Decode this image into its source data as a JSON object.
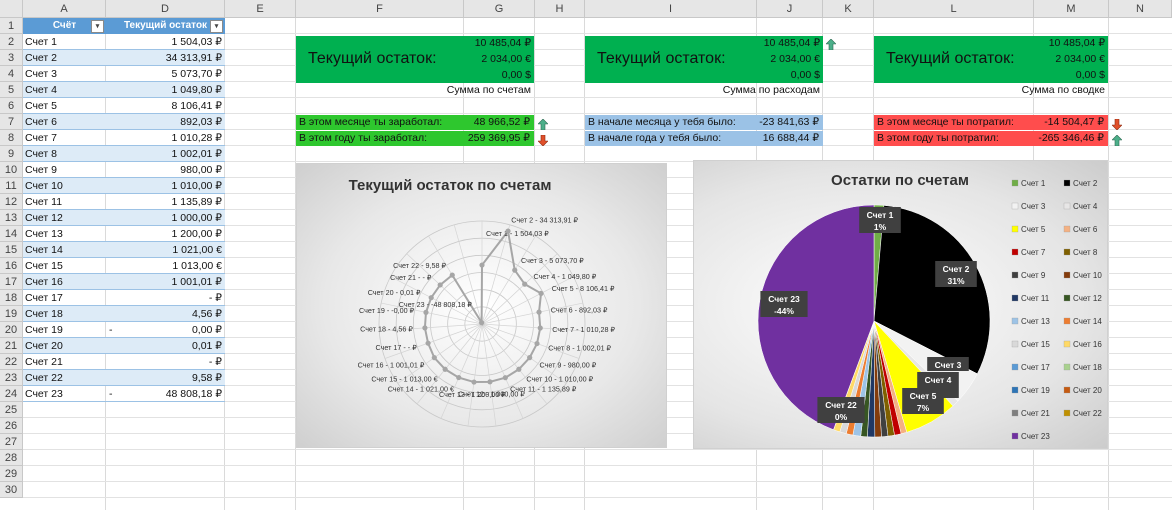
{
  "columns": [
    "A",
    "D",
    "E",
    "F",
    "G",
    "H",
    "I",
    "J",
    "K",
    "L",
    "M",
    "N"
  ],
  "rows": [
    "1",
    "2",
    "3",
    "4",
    "5",
    "6",
    "7",
    "8",
    "9",
    "10",
    "11",
    "12",
    "13",
    "14",
    "15",
    "16",
    "17",
    "18",
    "19",
    "20",
    "21",
    "22",
    "23",
    "24",
    "25",
    "26",
    "27",
    "28",
    "29",
    "30"
  ],
  "table": {
    "header_account": "Счёт",
    "header_balance": "Текущий остаток",
    "accounts": [
      {
        "name": "Счет 1",
        "minus": "",
        "value": "1 504,03 ₽"
      },
      {
        "name": "Счет 2",
        "minus": "",
        "value": "34 313,91 ₽"
      },
      {
        "name": "Счет 3",
        "minus": "",
        "value": "5 073,70 ₽"
      },
      {
        "name": "Счет 4",
        "minus": "",
        "value": "1 049,80 ₽"
      },
      {
        "name": "Счет 5",
        "minus": "",
        "value": "8 106,41 ₽"
      },
      {
        "name": "Счет 6",
        "minus": "",
        "value": "892,03 ₽"
      },
      {
        "name": "Счет 7",
        "minus": "",
        "value": "1 010,28 ₽"
      },
      {
        "name": "Счет 8",
        "minus": "",
        "value": "1 002,01 ₽"
      },
      {
        "name": "Счет 9",
        "minus": "",
        "value": "980,00 ₽"
      },
      {
        "name": "Счет 10",
        "minus": "",
        "value": "1 010,00 ₽"
      },
      {
        "name": "Счет 11",
        "minus": "",
        "value": "1 135,89 ₽"
      },
      {
        "name": "Счет 12",
        "minus": "",
        "value": "1 000,00 ₽"
      },
      {
        "name": "Счет 13",
        "minus": "",
        "value": "1 200,00 ₽"
      },
      {
        "name": "Счет 14",
        "minus": "",
        "value": "1 021,00 €"
      },
      {
        "name": "Счет 15",
        "minus": "",
        "value": "1 013,00 €"
      },
      {
        "name": "Счет 16",
        "minus": "",
        "value": "1 001,01 ₽"
      },
      {
        "name": "Счет 17",
        "minus": "",
        "value": "-     ₽"
      },
      {
        "name": "Счет 18",
        "minus": "",
        "value": "4,56 ₽"
      },
      {
        "name": "Счет 19",
        "minus": "-",
        "value": "0,00 ₽"
      },
      {
        "name": "Счет 20",
        "minus": "",
        "value": "0,01 ₽"
      },
      {
        "name": "Счет 21",
        "minus": "",
        "value": "-     ₽"
      },
      {
        "name": "Счет 22",
        "minus": "",
        "value": "9,58 ₽"
      },
      {
        "name": "Счет 23",
        "minus": "-",
        "value": "48 808,18 ₽"
      }
    ]
  },
  "panels": {
    "accounts": {
      "label": "Текущий остаток:",
      "v1": "10 485,04 ₽",
      "v2": "2 034,00 €",
      "v3": "0,00 $",
      "caption": "Сумма по счетам"
    },
    "expenses": {
      "label": "Текущий остаток:",
      "v1": "10 485,04 ₽",
      "v2": "2 034,00 €",
      "v3": "0,00 $",
      "caption": "Сумма по расходам"
    },
    "summary": {
      "label": "Текущий остаток:",
      "v1": "10 485,04 ₽",
      "v2": "2 034,00 €",
      "v3": "0,00 $",
      "caption": "Сумма по сводке"
    }
  },
  "earned": {
    "month_label": "В этом месяце ты заработал:",
    "month_value": "48 966,52 ₽",
    "year_label": "В этом году ты заработал:",
    "year_value": "259 369,95 ₽"
  },
  "start": {
    "month_label": "В начале месяца у тебя было:",
    "month_value": "-23 841,63 ₽",
    "year_label": "В начале года у тебя было:",
    "year_value": "16 688,44 ₽"
  },
  "spent": {
    "month_label": "В этом месяце ты потратил:",
    "month_value": "-14 504,47 ₽",
    "year_label": "В этом году ты потратил:",
    "year_value": "-265 346,46 ₽"
  },
  "colors": {
    "green": "#00b050",
    "green_light": "#2ec72e",
    "blue": "#9bc2e6",
    "red": "#ff4d4d",
    "header_blue": "#5b9bd5",
    "band": "#ddebf7",
    "up_arrow": "#4caf8a",
    "down_arrow": "#e0502a"
  },
  "icons": [
    "up-arrow-icon",
    "down-arrow-icon",
    "filter-dropdown-icon"
  ],
  "chart_data": [
    {
      "type": "radar",
      "title": "Текущий остаток по счетам",
      "categories": [
        "Счет 1",
        "Счет 2",
        "Счет 3",
        "Счет 4",
        "Счет 5",
        "Счет 6",
        "Счет 7",
        "Счет 8",
        "Счет 9",
        "Счет 10",
        "Счет 11",
        "Счет 12",
        "Счет 13",
        "Счет 14",
        "Счет 15",
        "Счет 16",
        "Счет 17",
        "Счет 18",
        "Счет 19",
        "Счет 20",
        "Счет 21",
        "Счет 22",
        "Счет 23"
      ],
      "values": [
        1504.03,
        34313.91,
        5073.7,
        1049.8,
        8106.41,
        892.03,
        1010.28,
        1002.01,
        980.0,
        1010.0,
        1135.89,
        1000.0,
        1200.0,
        1021.0,
        1013.0,
        1001.01,
        0,
        4.56,
        -0.0,
        0.01,
        0,
        9.58,
        -48808.18
      ],
      "data_labels": [
        "Счет 1 - 1 504,03 ₽",
        "Счет 2 - 34 313,91 ₽",
        "Счет 3 - 5 073,70 ₽",
        "Счет 4 - 1 049,80 ₽",
        "Счет 5 - 8 106,41 ₽",
        "Счет 6 - 892,03 ₽",
        "Счет 7 - 1 010,28 ₽",
        "Счет 8 - 1 002,01 ₽",
        "Счет 9 - 980,00 ₽",
        "Счет 10 - 1 010,00 ₽",
        "Счет 11 - 1 135,89 ₽",
        "Счет 12 - 1 000,00 ₽",
        "Счет 13 - 1 200,00 ₽",
        "Счет 14 - 1 021,00 €",
        "Счет 15 - 1 013,00 €",
        "Счет 16 - 1 001,01 ₽",
        "Счет 17 - - ₽",
        "Счет 18 - 4,56 ₽",
        "Счет 19 - -0,00 ₽",
        "Счет 20 - 0,01 ₽",
        "Счет 21 - - ₽",
        "Счет 22 - 9,58 ₽",
        "Счет 23 - -48 808,18 ₽"
      ]
    },
    {
      "type": "pie",
      "title": "Остатки по счетам",
      "legend_position": "right",
      "slices": [
        {
          "name": "Счет 1",
          "pct_label": "1%",
          "color": "#70ad47"
        },
        {
          "name": "Счет 2",
          "pct_label": "31%",
          "color": "#000000"
        },
        {
          "name": "Счет 3",
          "pct_label": "",
          "color": "#f2f2f2"
        },
        {
          "name": "Счет 4",
          "pct_label": "",
          "color": "#e7e6e6"
        },
        {
          "name": "Счет 5",
          "pct_label": "",
          "color": "#ffff00"
        },
        {
          "name": "Счет 6",
          "pct_label": "",
          "color": "#f4b183"
        },
        {
          "name": "Счет 7",
          "pct_label": "",
          "color": "#c00000"
        },
        {
          "name": "Счет 8",
          "pct_label": "",
          "color": "#7f6000"
        },
        {
          "name": "Счет 9",
          "pct_label": "",
          "color": "#404040"
        },
        {
          "name": "Счет 10",
          "pct_label": "",
          "color": "#843c0c"
        },
        {
          "name": "Счет 11",
          "pct_label": "",
          "color": "#203864"
        },
        {
          "name": "Счет 12",
          "pct_label": "",
          "color": "#375623"
        },
        {
          "name": "Счет 13",
          "pct_label": "",
          "color": "#9dc3e6"
        },
        {
          "name": "Счет 14",
          "pct_label": "",
          "color": "#ed7d31"
        },
        {
          "name": "Счет 15",
          "pct_label": "",
          "color": "#d9d9d9"
        },
        {
          "name": "Счет 16",
          "pct_label": "",
          "color": "#ffd966"
        },
        {
          "name": "Счет 17",
          "pct_label": "",
          "color": "#5b9bd5"
        },
        {
          "name": "Счет 18",
          "pct_label": "",
          "color": "#a9d18e"
        },
        {
          "name": "Счет 19",
          "pct_label": "",
          "color": "#2e75b6"
        },
        {
          "name": "Счет 20",
          "pct_label": "",
          "color": "#c55a11"
        },
        {
          "name": "Счет 21",
          "pct_label": "",
          "color": "#7f7f7f"
        },
        {
          "name": "Счет 22",
          "pct_label": "0%",
          "color": "#bf9000"
        },
        {
          "name": "Счет 23",
          "pct_label": "-44%",
          "color": "#7030a0"
        }
      ],
      "values": [
        1504.03,
        34313.91,
        5073.7,
        1049.8,
        8106.41,
        892.03,
        1010.28,
        1002.01,
        980.0,
        1010.0,
        1135.89,
        1000.0,
        1200.0,
        1021.0,
        1013.0,
        1001.01,
        0,
        4.56,
        0,
        0.01,
        0,
        9.58,
        48808.18
      ],
      "visible_pct_labels": [
        {
          "name": "Счет 1",
          "pct": "1%"
        },
        {
          "name": "Счет 2",
          "pct": "31%"
        },
        {
          "name": "Счет 3",
          "pct": ""
        },
        {
          "name": "Счет 4",
          "pct": "%"
        },
        {
          "name": "Счет 5",
          "pct": "7%"
        },
        {
          "name": "Счет 22",
          "pct": "0%"
        },
        {
          "name": "Счет 23",
          "pct": "-44%"
        }
      ]
    }
  ]
}
